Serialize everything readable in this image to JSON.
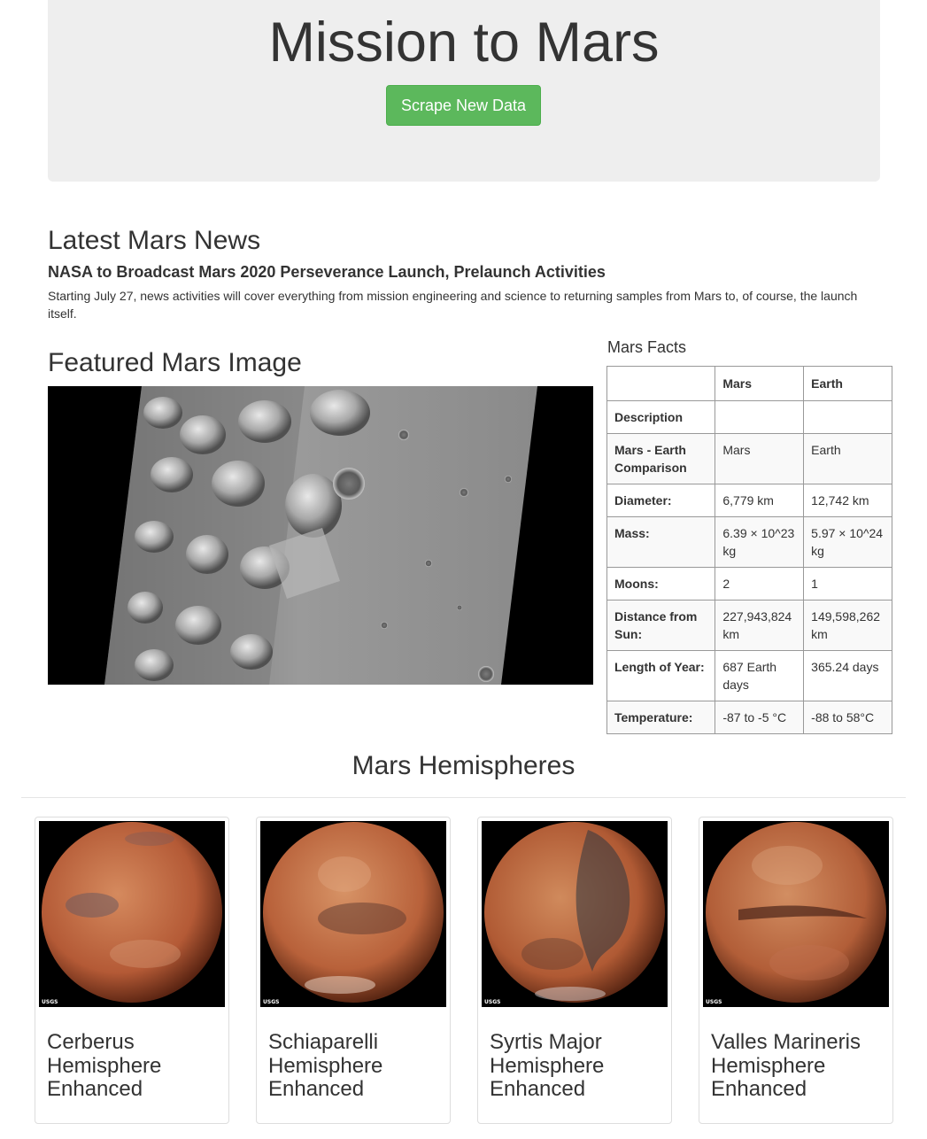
{
  "header": {
    "title": "Mission to Mars",
    "scrape_button": "Scrape New Data",
    "accent_color": "#5cb85c"
  },
  "news": {
    "heading": "Latest Mars News",
    "title": "NASA to Broadcast Mars 2020 Perseverance Launch, Prelaunch Activities",
    "paragraph": "Starting July 27, news activities will cover everything from mission engineering and science to returning samples from Mars to, of course, the launch itself."
  },
  "featured": {
    "heading": "Featured Mars Image"
  },
  "facts": {
    "caption": "Mars Facts",
    "columns": [
      "",
      "Mars",
      "Earth"
    ],
    "rows": [
      [
        "Description",
        "",
        ""
      ],
      [
        "Mars - Earth Comparison",
        "Mars",
        "Earth"
      ],
      [
        "Diameter:",
        "6,779 km",
        "12,742 km"
      ],
      [
        "Mass:",
        "6.39 × 10^23 kg",
        "5.97 × 10^24 kg"
      ],
      [
        "Moons:",
        "2",
        "1"
      ],
      [
        "Distance from Sun:",
        "227,943,824 km",
        "149,598,262 km"
      ],
      [
        "Length of Year:",
        "687 Earth days",
        "365.24 days"
      ],
      [
        "Temperature:",
        "-87 to -5 °C",
        "-88 to 58°C"
      ]
    ]
  },
  "hemispheres": {
    "heading": "Mars Hemispheres",
    "items": [
      {
        "title": "Cerberus Hemisphere Enhanced",
        "logo": "USGS"
      },
      {
        "title": "Schiaparelli Hemisphere Enhanced",
        "logo": "USGS"
      },
      {
        "title": "Syrtis Major Hemisphere Enhanced",
        "logo": "USGS"
      },
      {
        "title": "Valles Marineris Hemisphere Enhanced",
        "logo": "USGS"
      }
    ]
  }
}
